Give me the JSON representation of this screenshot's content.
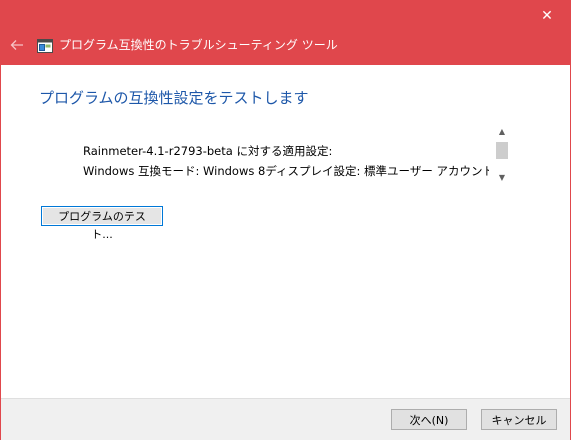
{
  "window": {
    "title": "プログラム互換性のトラブルシューティング ツール",
    "close_glyph": "✕",
    "back_glyph": "←",
    "accent_color": "#e0474c"
  },
  "main": {
    "heading": "プログラムの互換性設定をテストします",
    "settings_lines": [
      "Rainmeter-4.1-r2793-beta に対する適用設定:",
      "Windows 互換モード: Windows 8ディスプレイ設定: 標準ユーザー アカウント"
    ],
    "test_button_label": "プログラムのテスト..."
  },
  "footer": {
    "next_label": "次へ(N)",
    "cancel_label": "キャンセル"
  }
}
